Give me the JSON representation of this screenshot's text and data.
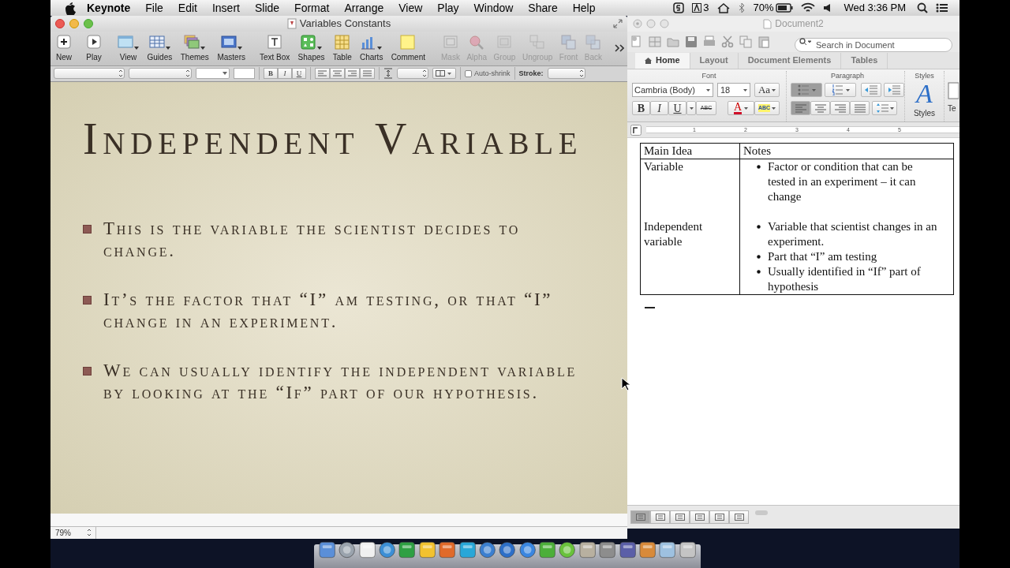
{
  "menubar": {
    "app": "Keynote",
    "menus": [
      "File",
      "Edit",
      "Insert",
      "Slide",
      "Format",
      "Arrange",
      "View",
      "Play",
      "Window",
      "Share",
      "Help"
    ],
    "status_count": "3",
    "battery": "70%",
    "clock": "Wed 3:36 PM"
  },
  "keynote": {
    "title": "Variables Constants",
    "toolbar": [
      [
        {
          "label": "New",
          "menu": false,
          "disabled": false
        },
        {
          "label": "Play",
          "menu": false,
          "disabled": false
        }
      ],
      [
        {
          "label": "View",
          "menu": true,
          "disabled": false
        },
        {
          "label": "Guides",
          "menu": true,
          "disabled": false
        },
        {
          "label": "Themes",
          "menu": true,
          "disabled": false
        },
        {
          "label": "Masters",
          "menu": true,
          "disabled": false
        }
      ],
      [
        {
          "label": "Text Box",
          "menu": false,
          "disabled": false
        },
        {
          "label": "Shapes",
          "menu": true,
          "disabled": false
        },
        {
          "label": "Table",
          "menu": false,
          "disabled": false
        },
        {
          "label": "Charts",
          "menu": true,
          "disabled": false
        },
        {
          "label": "Comment",
          "menu": false,
          "disabled": false
        }
      ],
      [
        {
          "label": "Mask",
          "menu": false,
          "disabled": true
        },
        {
          "label": "Alpha",
          "menu": false,
          "disabled": true
        },
        {
          "label": "Group",
          "menu": false,
          "disabled": true
        },
        {
          "label": "Ungroup",
          "menu": false,
          "disabled": true
        },
        {
          "label": "Front",
          "menu": false,
          "disabled": true
        },
        {
          "label": "Back",
          "menu": false,
          "disabled": true
        }
      ]
    ],
    "style_buttons": [
      "B",
      "I",
      "U"
    ],
    "auto_shrink": {
      "label": "Auto-shrink",
      "checked": false
    },
    "stroke_label": "Stroke:",
    "slide": {
      "title": "Independent Variable",
      "bullets": [
        "This is the variable the scientist decides to change.",
        "It’s the factor that “I” am testing, or that “I” change in an experiment.",
        "We can usually identify the independent variable by looking at the “If” part of our hypothesis."
      ]
    },
    "zoom": "79%"
  },
  "word": {
    "title": "Document2",
    "search_placeholder": "Search in Document",
    "tabs": [
      {
        "label": "Home",
        "selected": true
      },
      {
        "label": "Layout",
        "selected": false
      },
      {
        "label": "Document Elements",
        "selected": false
      },
      {
        "label": "Tables",
        "selected": false
      }
    ],
    "font_group": "Font",
    "paragraph_group": "Paragraph",
    "styles_group": "Styles",
    "font_name": "Cambria (Body)",
    "font_size": "18",
    "grow_font": "Aa",
    "format_buttons": [
      "B",
      "I",
      "U"
    ],
    "strikethrough": "ABC",
    "font_color": "A",
    "highlight": "ABC",
    "list_buttons": [
      {
        "kind": "bullets",
        "selected": true
      },
      {
        "kind": "numbers",
        "selected": false
      }
    ],
    "align_buttons": [
      {
        "kind": "left",
        "selected": true
      },
      {
        "kind": "center",
        "selected": false
      },
      {
        "kind": "right",
        "selected": false
      },
      {
        "kind": "justify",
        "selected": false
      }
    ],
    "styles_glyph": "A",
    "styles_label": "Styles",
    "text_box_partial": "Te",
    "ruler": [
      "1",
      "2",
      "3",
      "4",
      "5"
    ],
    "table": {
      "columns": [
        "Main Idea",
        "Notes"
      ],
      "rows": [
        {
          "main": "Variable",
          "notes": [
            "Factor or condition that can be tested in an experiment – it can change"
          ]
        },
        {
          "main": "Independent variable",
          "notes": [
            "Variable that scientist changes in an experiment.",
            "Part that “I” am testing",
            "Usually identified in “If” part of hypothesis"
          ]
        }
      ]
    },
    "view_buttons": [
      {
        "selected": true
      },
      {
        "selected": false
      },
      {
        "selected": false
      },
      {
        "selected": false
      },
      {
        "selected": false
      },
      {
        "selected": false
      }
    ]
  }
}
